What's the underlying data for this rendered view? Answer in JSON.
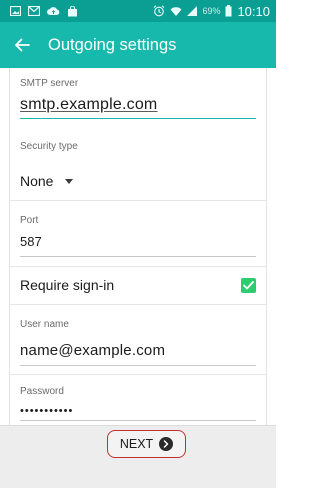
{
  "status_bar": {
    "left_icons": [
      "photo-icon",
      "mail-icon",
      "cloud-upload-icon",
      "shopping-bag-icon"
    ],
    "right_icons": [
      "alarm-icon",
      "wifi-icon",
      "signal-icon",
      "battery-icon"
    ],
    "battery_percent": "69%",
    "time": "10:10"
  },
  "app_bar": {
    "title": "Outgoing settings",
    "back_icon": "back-arrow-icon"
  },
  "form": {
    "smtp_server": {
      "label": "SMTP server",
      "value": "smtp.example.com"
    },
    "security_type": {
      "label": "Security type",
      "value": "None"
    },
    "port": {
      "label": "Port",
      "value": "587"
    },
    "require_sign_in": {
      "label": "Require sign-in",
      "checked": true
    },
    "user_name": {
      "label": "User name",
      "value": "name@example.com"
    },
    "password": {
      "label": "Password",
      "value": "•••••••••••"
    }
  },
  "footer": {
    "next_label": "NEXT"
  },
  "colors": {
    "status_bar": "#0b9f94",
    "app_bar": "#17b9ad",
    "checkbox": "#2ecc71",
    "highlight": "#c0302e"
  }
}
